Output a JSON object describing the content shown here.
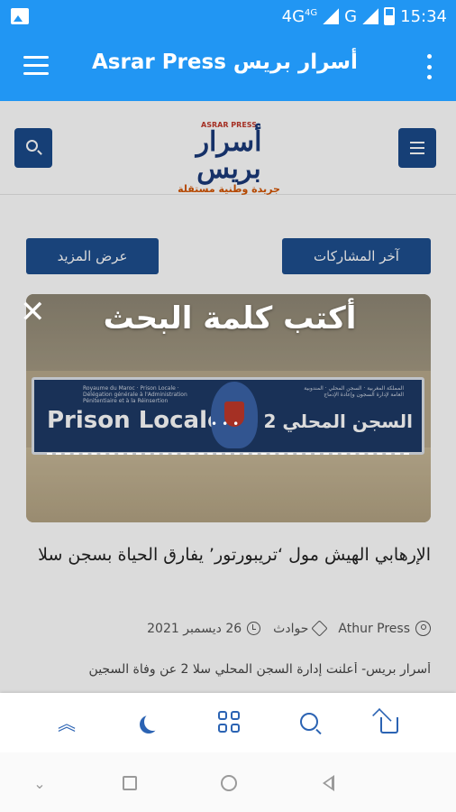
{
  "status_bar": {
    "network_label": "4G",
    "network_sup": "4G",
    "g_label": "G",
    "time": "15:34"
  },
  "app_bar": {
    "title": "Asrar Press أسرار بريس"
  },
  "site_header": {
    "logo_small": "ASRAR PRESS",
    "logo_main": "أسرار بريس",
    "logo_tagline": "جريدة وطنية مستقلة"
  },
  "buttons": {
    "show_more": "عرض المزيد",
    "latest_posts": "آخر المشاركات"
  },
  "search_overlay": {
    "hint": "أكتب كلمة البحث",
    "close": "✕",
    "dots": "•••"
  },
  "hero_image": {
    "sign_fr": "Prison Locale 2",
    "sign_ar": "السجن المحلي 2",
    "sign_fr_small": "Royaume du Maroc · Prison Locale · Délégation générale à l'Administration Pénitentiaire et à la Réinsertion",
    "sign_ar_small": "المملكة المغربية · السجن المحلي · المندوبية العامة لإدارة السجون وإعادة الإدماج"
  },
  "article": {
    "title": "الإرهابي الهيش مول ‘تريبورتور’ يفارق الحياة بسجن سلا",
    "author": "Athur Press",
    "category": "حوادث",
    "date": "26 ديسمبر 2021",
    "excerpt": "أسرار بريس- أعلنت إدارة السجن المحلي سلا 2 عن وفاة السجين"
  },
  "bottom_nav": {
    "scroll_top_glyph": "︽"
  },
  "system_nav": {
    "down_glyph": "⌄"
  }
}
